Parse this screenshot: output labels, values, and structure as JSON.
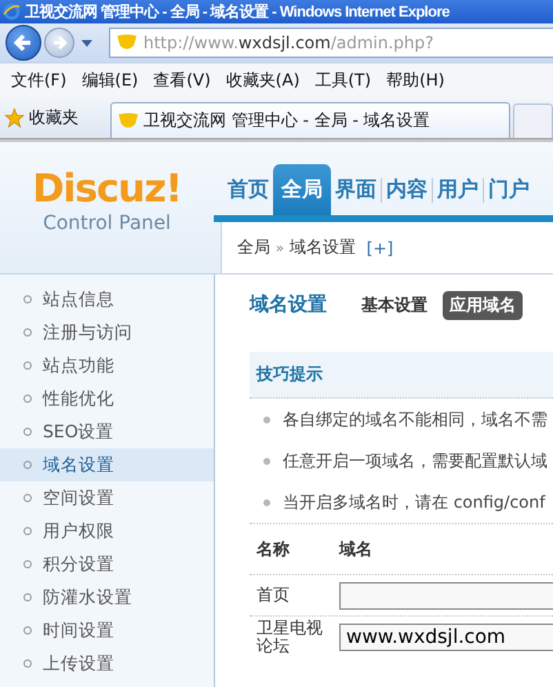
{
  "window": {
    "title": "卫视交流网 管理中心 - 全局 - 域名设置 - Windows Internet Explore"
  },
  "address": {
    "value_host": "http://www.",
    "value_domain": "wxdsjl.com",
    "value_path": "/admin.php?"
  },
  "menu": [
    "文件(F)",
    "编辑(E)",
    "查看(V)",
    "收藏夹(A)",
    "工具(T)",
    "帮助(H)"
  ],
  "favorites": {
    "label": "收藏夹",
    "tab": "卫视交流网 管理中心 - 全局 - 域名设置"
  },
  "logo": {
    "brand": "Discuz!",
    "subtitle": "Control Panel"
  },
  "nav_tabs": [
    {
      "label": "首页",
      "selected": false
    },
    {
      "label": "全局",
      "selected": true
    },
    {
      "label": "界面",
      "selected": false
    },
    {
      "label": "内容",
      "selected": false
    },
    {
      "label": "用户",
      "selected": false
    },
    {
      "label": "门户",
      "selected": false
    }
  ],
  "breadcrumb": {
    "parts": [
      "全局",
      "域名设置"
    ],
    "separator": "»",
    "add": "[+]"
  },
  "sidebar": {
    "items": [
      {
        "label": "站点信息",
        "selected": false
      },
      {
        "label": "注册与访问",
        "selected": false
      },
      {
        "label": "站点功能",
        "selected": false
      },
      {
        "label": "性能优化",
        "selected": false
      },
      {
        "label": "SEO设置",
        "selected": false
      },
      {
        "label": "域名设置",
        "selected": true
      },
      {
        "label": "空间设置",
        "selected": false
      },
      {
        "label": "用户权限",
        "selected": false
      },
      {
        "label": "积分设置",
        "selected": false
      },
      {
        "label": "防灌水设置",
        "selected": false
      },
      {
        "label": "时间设置",
        "selected": false
      },
      {
        "label": "上传设置",
        "selected": false
      }
    ]
  },
  "page": {
    "title": "域名设置",
    "sub_tabs": [
      {
        "label": "基本设置",
        "selected": false
      },
      {
        "label": "应用域名",
        "selected": true
      }
    ]
  },
  "tips": {
    "title": "技巧提示",
    "items": [
      "各自绑定的域名不能相同，域名不需",
      "任意开启一项域名，需要配置默认域",
      "当开启多域名时，请在  config/conf"
    ]
  },
  "table": {
    "columns": [
      "名称",
      "域名"
    ],
    "rows": [
      {
        "name": "首页"
      },
      {
        "name": "卫星电视论坛",
        "value": "www.wxdsjl.com"
      }
    ]
  }
}
